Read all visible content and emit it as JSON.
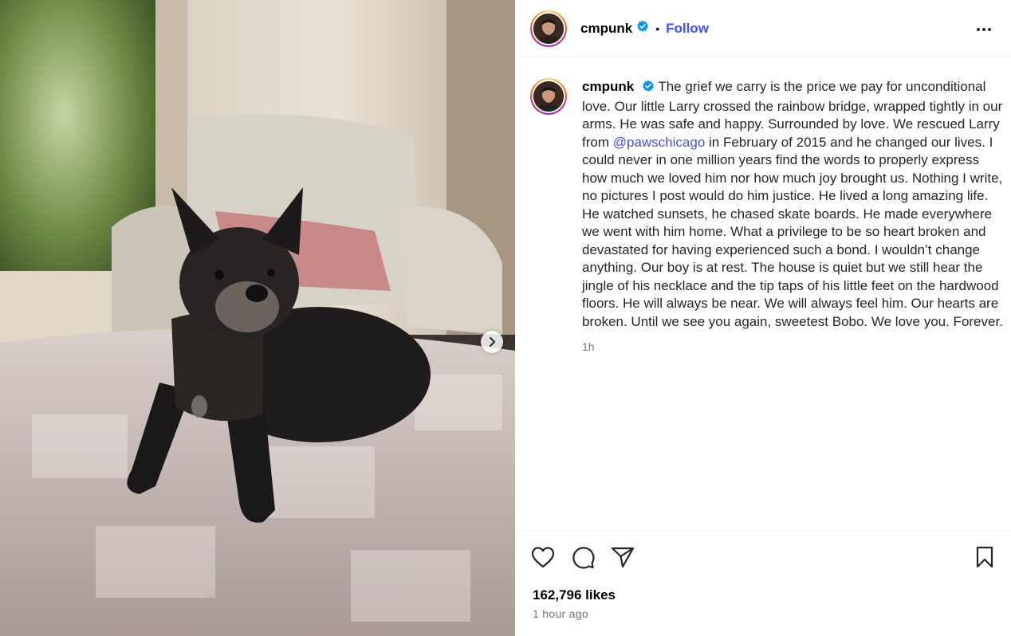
{
  "post": {
    "username": "cmpunk",
    "follow_label": "Follow",
    "separator": "•",
    "caption": {
      "username": "cmpunk",
      "text_before_mention": "The grief we carry is the price we pay for unconditional love. Our little Larry crossed the rainbow bridge, wrapped tightly in our arms. He was safe and happy. Surrounded by love. We rescued Larry from ",
      "mention": "@pawschicago",
      "text_after_mention": " in February of 2015 and he changed our lives. I could never in one million years find the words to properly express how much we loved him nor how much joy brought us. Nothing I write, no pictures I post would do him justice. He lived a long amazing life. He watched sunsets, he chased skate boards. He made everywhere we went with him home. What a privilege to be so heart broken and devastated for having experienced such a bond. I wouldn’t change anything. Our boy is at rest. The house is quiet but we still hear the jingle of his necklace and the tip taps of his little feet on the hardwood floors. He will always be near. We will always feel him. Our hearts are broken. Until we see you again, sweetest Bobo. We love you. Forever.",
      "time": "1h"
    },
    "likes": "162,796 likes",
    "posted": "1 hour ago"
  },
  "icons": {
    "verified": "verified-badge-icon",
    "more": "more-options-icon",
    "like": "heart-icon",
    "comment": "comment-icon",
    "share": "share-icon",
    "save": "bookmark-icon",
    "next": "chevron-right-icon"
  },
  "colors": {
    "link": "#4150f7",
    "verified": "#0095f6",
    "muted": "#737373"
  }
}
